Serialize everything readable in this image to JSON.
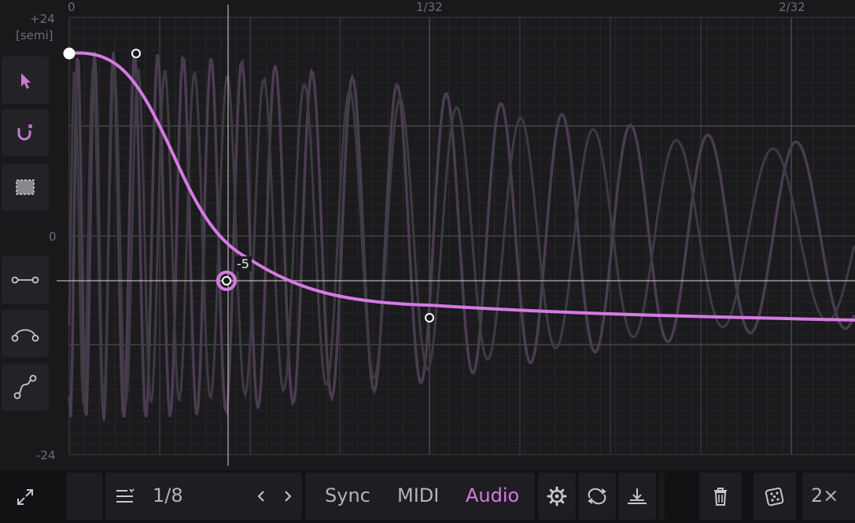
{
  "axes": {
    "y_top": "+24",
    "y_unit": "[semi]",
    "y_mid": "0",
    "y_bottom": "-24",
    "time_labels": [
      "0",
      "1/32",
      "2/32"
    ]
  },
  "point_value": "-5",
  "tools": [
    "pointer-icon",
    "magnet-icon",
    "select-box-icon",
    "flat-segment-icon",
    "curve-segment-icon",
    "s-curve-segment-icon"
  ],
  "toolbar": {
    "grid_value": "1/8",
    "sync_label": "Sync",
    "midi_label": "MIDI",
    "audio_label": "Audio",
    "zoom_label": "2×"
  },
  "colors": {
    "accent": "#d57ae3",
    "background": "#19181b",
    "text": "#b5b3b9"
  }
}
